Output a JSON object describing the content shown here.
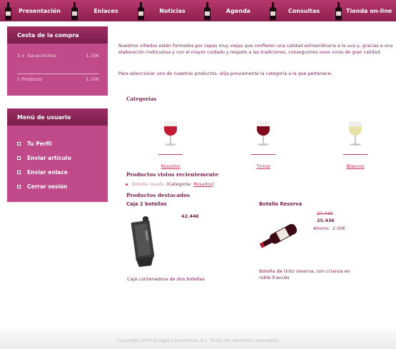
{
  "nav": {
    "items": [
      {
        "label": "Presentación"
      },
      {
        "label": "Enlaces"
      },
      {
        "label": "Noticias"
      },
      {
        "label": "Agenda"
      },
      {
        "label": "Consultas"
      },
      {
        "label": "Tienda on-line"
      }
    ]
  },
  "cart": {
    "title": "Cesta de la compra",
    "item_qty": "1 x",
    "item_name": "Sacacorchos",
    "item_price": "1.10€",
    "summary_label": "1 Producto",
    "summary_price": "1.10€"
  },
  "user_menu": {
    "title": "Menú de usuario",
    "items": [
      {
        "label": "Tu Perfil"
      },
      {
        "label": "Enviar artículo"
      },
      {
        "label": "Enviar enlace"
      },
      {
        "label": "Cerrar sesión"
      }
    ]
  },
  "main": {
    "intro": "Nuestros viñedos están formados por cepas muy viejas que confieren una calidad extraordinaria a la uva y, gracias a una elaboración meticulosa y con el mayor cuidado y respeto a las tradiciones, conseguimos unos vinos de gran calidad.",
    "select_msg": "Para seleccionar uno de nuestros productos, elija previamente la categoría a la que pertenece:",
    "categories_title": "Categorías",
    "categories": [
      {
        "label": "Rosados",
        "wine_color": "#c21a33"
      },
      {
        "label": "Tintos",
        "wine_color": "#7d0b1c"
      },
      {
        "label": "Blancos",
        "wine_color": "#e9e2a8"
      }
    ],
    "recent_title": "Productos vistos recientemente",
    "recent_item": "Botella rosado",
    "recent_category_label": "(Categoría:",
    "recent_category_link": "Rosados",
    "recent_close": ")",
    "featured_title": "Productos destacados",
    "products": [
      {
        "title": "Caja 2 botellas",
        "price": "42.44€",
        "description": "Caja contenedora de dos botellas"
      },
      {
        "title": "Botella Reserva",
        "old_price": "27.43€",
        "price": "25.43€",
        "savings_label": "Ahorro:",
        "savings_value": "2.00€",
        "description": "Botella de tinto reserva, con crianza en roble francés"
      }
    ]
  },
  "footer": {
    "copyright": "Copyright 2009 Enogés Consultores, S.L. Todos los derechos reservados"
  }
}
